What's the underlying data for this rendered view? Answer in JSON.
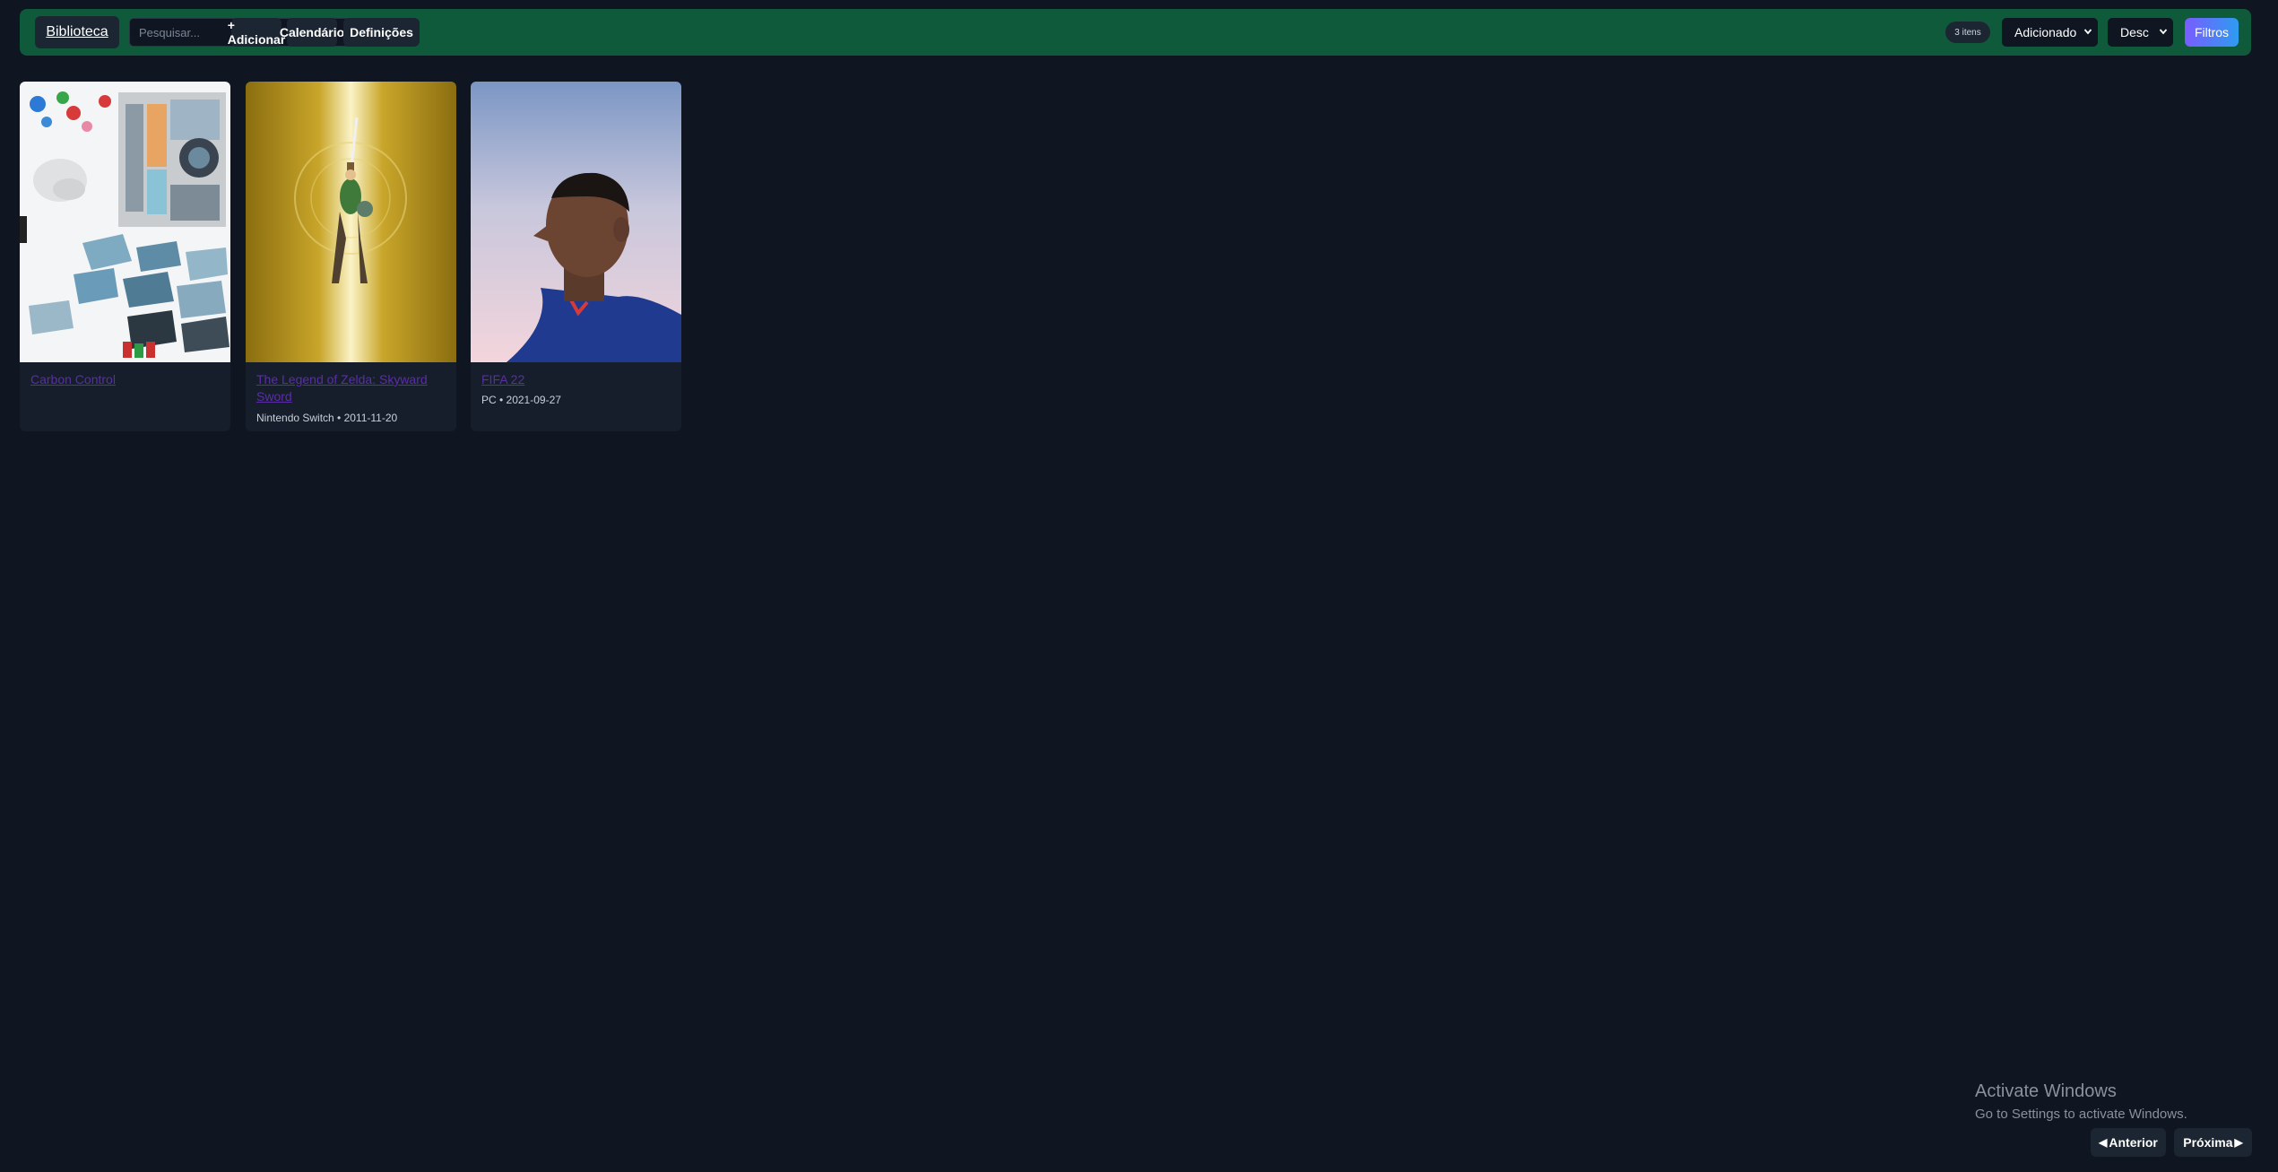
{
  "header": {
    "brand_label": "Biblioteca",
    "search_placeholder": "Pesquisar...",
    "add_label": "+ Adicionar",
    "calendar_label": "Calendário",
    "settings_label": "Definições",
    "count_badge": "3 itens",
    "sort_field": "Adicionado",
    "sort_order": "Desc",
    "filters_label": "Filtros"
  },
  "cards": [
    {
      "title": "Carbon Control",
      "meta": "",
      "cover_icon": "board-game-components-image"
    },
    {
      "title": "The Legend of Zelda: Skyward Sword",
      "meta": "Nintendo Switch • 2011-11-20",
      "cover_icon": "hero-raising-sword-image"
    },
    {
      "title": "FIFA 22",
      "meta": "PC • 2021-09-27",
      "cover_icon": "footballer-portrait-image"
    }
  ],
  "pagination": {
    "prev_label": "Anterior",
    "next_label": "Próxima",
    "prev_icon": "◀",
    "next_icon": "▶"
  },
  "watermark": {
    "title": "Activate Windows",
    "subtitle": "Go to Settings to activate Windows."
  },
  "colors": {
    "header_bg": "#0f5a3a",
    "page_bg": "#0f1621",
    "card_bg": "#161e2b",
    "link": "#5b2ea6",
    "filters_gradient_start": "#7a5cff",
    "filters_gradient_end": "#2d9cf0"
  }
}
